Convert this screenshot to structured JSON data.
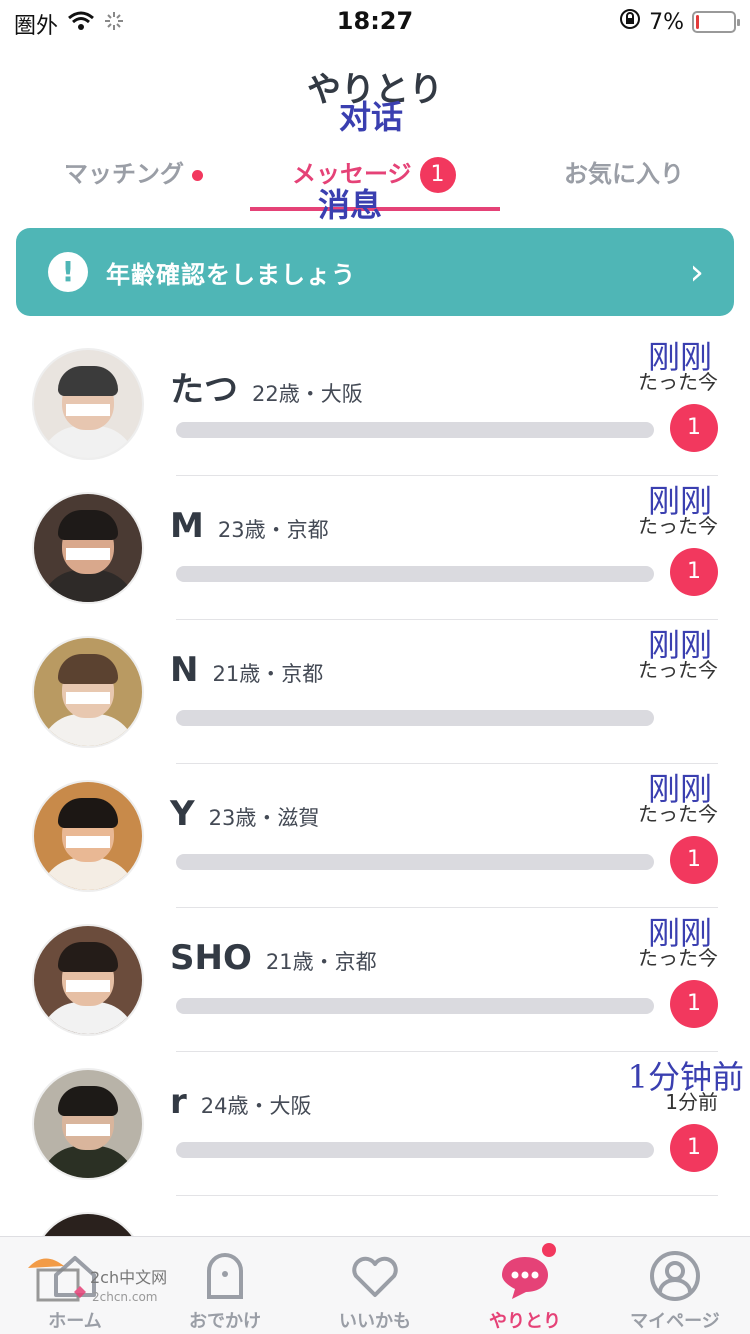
{
  "status_bar": {
    "carrier": "圏外",
    "time": "18:27",
    "battery": "7%",
    "battery_level": 0.07,
    "icons": [
      "wifi-icon",
      "loading-icon",
      "rotation-lock-icon",
      "battery-icon"
    ]
  },
  "header": {
    "title": "やりとり",
    "title_overlay": "对话"
  },
  "tabs": {
    "matching": "マッチング",
    "message": "メッセージ",
    "message_badge": "1",
    "favorites": "お気に入り",
    "message_overlay": "消息"
  },
  "banner": {
    "text": "年齢確認をしましょう",
    "icon": "!",
    "chevron": "›"
  },
  "conversations": [
    {
      "name": "たつ",
      "meta": "22歳・大阪",
      "time": "たった今",
      "time_overlay": "刚刚",
      "unread": "1"
    },
    {
      "name": "M",
      "meta": "23歳・京都",
      "time": "たった今",
      "time_overlay": "刚刚",
      "unread": "1"
    },
    {
      "name": "N",
      "meta": "21歳・京都",
      "time": "たった今",
      "time_overlay": "刚刚",
      "unread": ""
    },
    {
      "name": "Y",
      "meta": "23歳・滋賀",
      "time": "たった今",
      "time_overlay": "刚刚",
      "unread": "1"
    },
    {
      "name": "SHO",
      "meta": "21歳・京都",
      "time": "たった今",
      "time_overlay": "刚刚",
      "unread": "1"
    },
    {
      "name": "r",
      "meta": "24歳・大阪",
      "time": "1分前",
      "time_overlay": "1分钟前",
      "unread": "1"
    }
  ],
  "tabbar": {
    "home": "ホーム",
    "outing": "おでかけ",
    "maybe_like": "いいかも",
    "chat": "やりとり",
    "mypage": "マイページ"
  },
  "watermark": {
    "text": "2ch中文网",
    "sub": "2chcn.com"
  },
  "colors": {
    "accent": "#e54277",
    "badge": "#f2385e",
    "banner": "#4fb6b6",
    "overlay_text": "#3a3fb0"
  }
}
